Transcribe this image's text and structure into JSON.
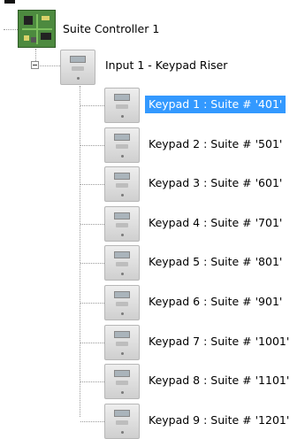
{
  "tree": {
    "root": {
      "label": "Suite Controller 1",
      "icon": "circuit-board-icon"
    },
    "input": {
      "label": "Input 1 - Keypad Riser",
      "icon": "keypad-device-icon",
      "expanded": true
    },
    "keypads": [
      {
        "label": "Keypad 1  :  Suite # '401'",
        "selected": true
      },
      {
        "label": "Keypad 2  :  Suite # '501'",
        "selected": false
      },
      {
        "label": "Keypad 3  :  Suite # '601'",
        "selected": false
      },
      {
        "label": "Keypad 4  :  Suite # '701'",
        "selected": false
      },
      {
        "label": "Keypad 5  :  Suite # '801'",
        "selected": false
      },
      {
        "label": "Keypad 6  :  Suite # '901'",
        "selected": false
      },
      {
        "label": "Keypad 7  :  Suite # '1001'",
        "selected": false
      },
      {
        "label": "Keypad 8  :  Suite # '1101'",
        "selected": false
      },
      {
        "label": "Keypad 9  :  Suite # '1201'",
        "selected": false
      }
    ]
  },
  "colors": {
    "selection": "#3399ff",
    "selection_text": "#ffffff",
    "tree_line": "#9a9a9a"
  }
}
